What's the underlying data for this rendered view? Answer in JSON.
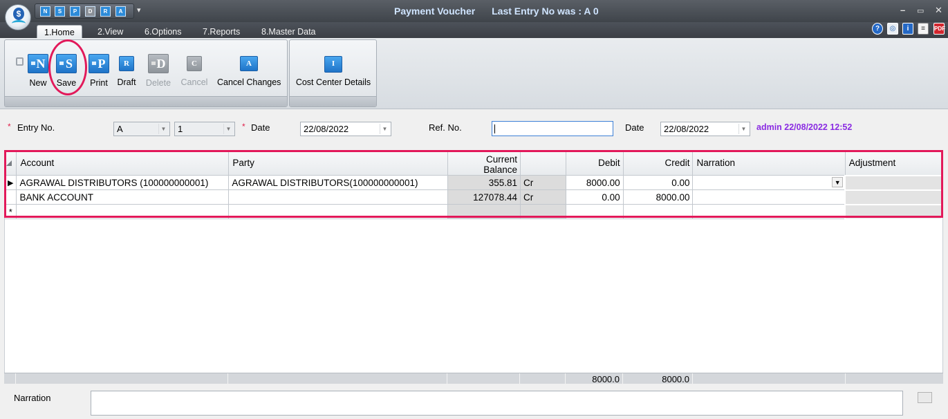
{
  "window": {
    "title": "Payment Voucher",
    "last_entry": "Last Entry No was : A 0",
    "minimize": "–",
    "maximize": "▭",
    "close": "✕"
  },
  "quick_access": {
    "buttons": [
      "N",
      "S",
      "P",
      "D",
      "R",
      "A"
    ],
    "more": "▾"
  },
  "menu": {
    "tabs": [
      "1.Home",
      "2.View",
      "6.Options",
      "7.Reports",
      "8.Master Data"
    ],
    "active_tab": "1.Home",
    "right_icons": [
      "help-icon",
      "support-icon",
      "info-icon",
      "notes-icon",
      "pdf-icon"
    ]
  },
  "ribbon": {
    "buttons": [
      {
        "label": "New",
        "letter": "N",
        "enabled": true
      },
      {
        "label": "Save",
        "letter": "S",
        "enabled": true
      },
      {
        "label": "Print",
        "letter": "P",
        "enabled": true
      },
      {
        "label": "Draft",
        "letter": "R",
        "enabled": true
      },
      {
        "label": "Delete",
        "letter": "D",
        "enabled": false
      },
      {
        "label": "Cancel",
        "letter": "C",
        "enabled": false
      },
      {
        "label": "Cancel Changes",
        "letter": "A",
        "enabled": true
      }
    ],
    "extra": {
      "label": "Cost Center Details",
      "letter": "I"
    }
  },
  "form": {
    "required_mark": "*",
    "entry_no_label": "Entry No.",
    "series_value": "A",
    "entry_no_value": "1",
    "date_label": "Date",
    "date_value": "22/08/2022",
    "ref_no_label": "Ref. No.",
    "ref_no_value": "",
    "ref_date_label": "Date",
    "ref_date_value": "22/08/2022",
    "audit": "admin 22/08/2022 12:52"
  },
  "grid": {
    "columns": [
      "Account",
      "Party",
      "Current Balance",
      "",
      "Debit",
      "Credit",
      "Narration",
      "Adjustment"
    ],
    "rows": [
      {
        "account": "AGRAWAL DISTRIBUTORS (100000000001)",
        "party": "AGRAWAL DISTRIBUTORS(100000000001)",
        "balance": "355.81",
        "dr_cr": "Cr",
        "debit": "8000.00",
        "credit": "0.00",
        "narration": "",
        "adjustment": ""
      },
      {
        "account": "BANK ACCOUNT",
        "party": "",
        "balance": "127078.44",
        "dr_cr": "Cr",
        "debit": "0.00",
        "credit": "8000.00",
        "narration": "",
        "adjustment": ""
      }
    ],
    "new_row_marker": "*",
    "current_row_marker": "▶",
    "dropdown_arrow": "▼",
    "totals": {
      "debit": "8000.0",
      "credit": "8000.0"
    }
  },
  "narration": {
    "label": "Narration",
    "value": ""
  },
  "colors": {
    "highlight": "#e2195a",
    "accent": "#1f74c8",
    "audit_text": "#8a2be2"
  }
}
